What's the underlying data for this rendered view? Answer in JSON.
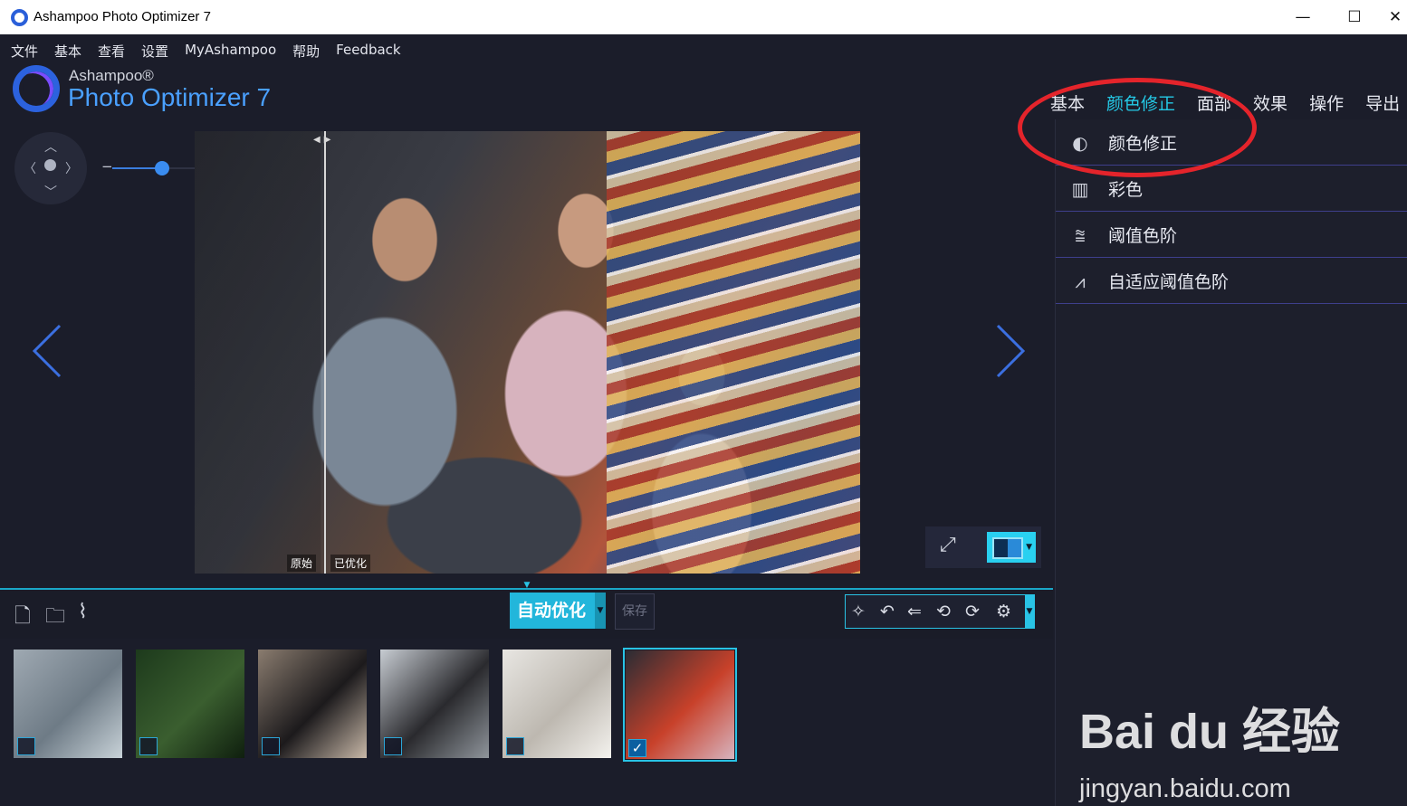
{
  "window": {
    "title": "Ashampoo Photo Optimizer 7",
    "minimize": "—",
    "maximize": "☐",
    "close": "✕"
  },
  "menubar": [
    "文件",
    "基本",
    "查看",
    "设置",
    "MyAshampoo",
    "帮助",
    "Feedback"
  ],
  "logo": {
    "brand": "Ashampoo®",
    "product": "Photo Optimizer 7"
  },
  "tabs": [
    {
      "label": "基本",
      "active": false
    },
    {
      "label": "颜色修正",
      "active": true
    },
    {
      "label": "面部",
      "active": false
    },
    {
      "label": "效果",
      "active": false
    },
    {
      "label": "操作",
      "active": false
    },
    {
      "label": "导出",
      "active": false
    }
  ],
  "panel_items": [
    {
      "label": "颜色修正",
      "icon": "brightness-icon"
    },
    {
      "label": "彩色",
      "icon": "color-paint-icon"
    },
    {
      "label": "阈值色阶",
      "icon": "levels-chart-icon"
    },
    {
      "label": "自适应阈值色阶",
      "icon": "adaptive-levels-icon"
    }
  ],
  "zoom": {
    "minus": "−",
    "plus": "+",
    "level": 0.43
  },
  "compare_labels": {
    "original": "原始",
    "optimized": "已优化"
  },
  "toolbar": {
    "auto_optimize": "自动优化",
    "save": "保存"
  },
  "thumbnails": [
    {
      "checked": false,
      "colors": [
        "#9fa9b2",
        "#6e7b86",
        "#c8d2d8"
      ]
    },
    {
      "checked": false,
      "colors": [
        "#1d3a1c",
        "#3a5e2f",
        "#0f1f0e"
      ]
    },
    {
      "checked": false,
      "colors": [
        "#8a7c6f",
        "#1c1a1c",
        "#c8b8a8"
      ]
    },
    {
      "checked": false,
      "colors": [
        "#c7ccd2",
        "#2a2a2e",
        "#8f959b"
      ]
    },
    {
      "checked": false,
      "colors": [
        "#e8e6e2",
        "#bdb8b0",
        "#f4f2ee"
      ]
    },
    {
      "checked": true,
      "colors": [
        "#2a2c34",
        "#c8412a",
        "#d7b3be"
      ]
    }
  ],
  "watermark": {
    "brand": "Bai du 经验",
    "url": "jingyan.baidu.com"
  },
  "colors": {
    "accent": "#24c9e6",
    "highlight": "#e4242b",
    "background": "#1b1d2a"
  }
}
